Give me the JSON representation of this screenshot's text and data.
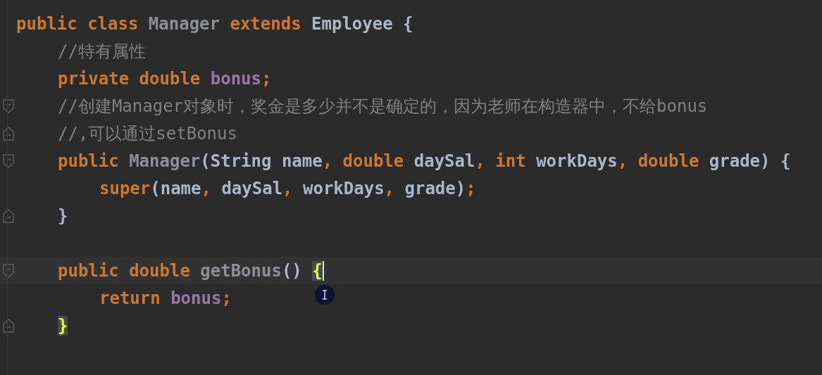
{
  "editor": {
    "lines": [
      {
        "kind": "code",
        "current": false,
        "caret": false,
        "fold_start": false,
        "fold_end": false,
        "tokens": [
          {
            "kind": "keyword",
            "text": "public class "
          },
          {
            "kind": "unused",
            "text": "Manager "
          },
          {
            "kind": "keyword",
            "text": "extends "
          },
          {
            "kind": "plain",
            "text": "Employee {"
          }
        ],
        "children": [
          {
            "kind": "code",
            "current": false,
            "caret": false,
            "fold_start": false,
            "fold_end": false,
            "tokens": [
              {
                "kind": "comment",
                "text": "//特有属性"
              }
            ]
          },
          {
            "kind": "code",
            "current": false,
            "caret": false,
            "fold_start": false,
            "fold_end": false,
            "tokens": [
              {
                "kind": "keyword",
                "text": "private double "
              },
              {
                "kind": "field",
                "text": "bonus"
              },
              {
                "kind": "keyword",
                "text": ";"
              }
            ]
          },
          {
            "kind": "code",
            "current": false,
            "caret": false,
            "fold_start": true,
            "fold_end": false,
            "tokens": [
              {
                "kind": "comment",
                "text": "//创建Manager对象时，奖金是多少并不是确定的，因为老师在构造器中，不给bonus"
              }
            ]
          },
          {
            "kind": "code",
            "current": false,
            "caret": false,
            "fold_start": false,
            "fold_end": true,
            "tokens": [
              {
                "kind": "comment",
                "text": "//,可以通过setBonus"
              }
            ]
          },
          {
            "kind": "code",
            "current": false,
            "caret": false,
            "fold_start": true,
            "fold_end": false,
            "tokens": [
              {
                "kind": "keyword",
                "text": "public "
              },
              {
                "kind": "unused",
                "text": "Manager"
              },
              {
                "kind": "plain",
                "text": "(String name"
              },
              {
                "kind": "keyword",
                "text": ", double "
              },
              {
                "kind": "plain",
                "text": "daySal"
              },
              {
                "kind": "keyword",
                "text": ", int "
              },
              {
                "kind": "plain",
                "text": "workDays"
              },
              {
                "kind": "keyword",
                "text": ", double "
              },
              {
                "kind": "plain",
                "text": "grade) {"
              }
            ],
            "children": [
              {
                "kind": "code",
                "current": false,
                "caret": false,
                "fold_start": false,
                "fold_end": false,
                "tokens": [
                  {
                    "kind": "keyword",
                    "text": "super"
                  },
                  {
                    "kind": "plain",
                    "text": "(name"
                  },
                  {
                    "kind": "keyword",
                    "text": ", "
                  },
                  {
                    "kind": "plain",
                    "text": "daySal"
                  },
                  {
                    "kind": "keyword",
                    "text": ", "
                  },
                  {
                    "kind": "plain",
                    "text": "workDays"
                  },
                  {
                    "kind": "keyword",
                    "text": ", "
                  },
                  {
                    "kind": "plain",
                    "text": "grade)"
                  },
                  {
                    "kind": "keyword",
                    "text": ";"
                  }
                ]
              }
            ]
          },
          {
            "kind": "code",
            "current": false,
            "caret": false,
            "fold_start": false,
            "fold_end": true,
            "tokens": [
              {
                "kind": "plain",
                "text": "}"
              }
            ]
          },
          {
            "kind": "blank"
          },
          {
            "kind": "code",
            "current": true,
            "caret": true,
            "fold_start": true,
            "fold_end": false,
            "tokens": [
              {
                "kind": "keyword",
                "text": "public double "
              },
              {
                "kind": "unused",
                "text": "getBonus"
              },
              {
                "kind": "plain",
                "text": "() "
              },
              {
                "kind": "brace-match",
                "text": "{"
              }
            ],
            "children": [
              {
                "kind": "code",
                "current": false,
                "caret": false,
                "fold_start": false,
                "fold_end": false,
                "tokens": [
                  {
                    "kind": "keyword",
                    "text": "return "
                  },
                  {
                    "kind": "field",
                    "text": "bonus"
                  },
                  {
                    "kind": "keyword",
                    "text": ";"
                  }
                ]
              }
            ]
          },
          {
            "kind": "code",
            "current": false,
            "caret": false,
            "fold_start": false,
            "fold_end": true,
            "tokens": [
              {
                "kind": "brace-match",
                "text": "}"
              }
            ]
          }
        ]
      }
    ]
  }
}
